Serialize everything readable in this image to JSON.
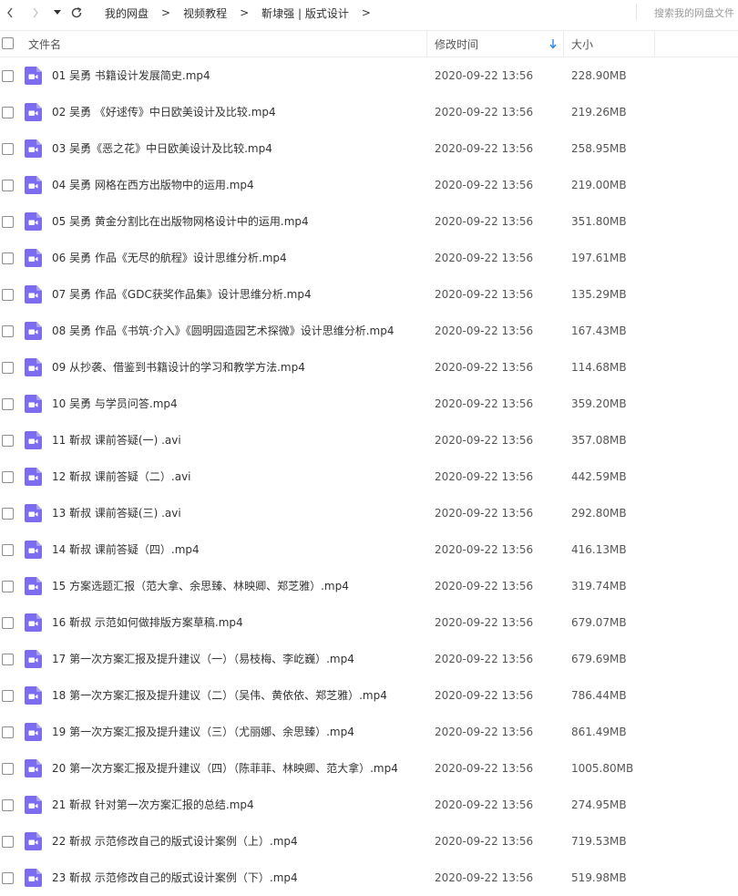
{
  "breadcrumb": {
    "items": [
      "我的网盘",
      "视频教程",
      "靳埭强 | 版式设计"
    ],
    "separator": ">"
  },
  "search": {
    "placeholder": "搜索我的网盘文件"
  },
  "columns": {
    "name": "文件名",
    "time": "修改时间",
    "size": "大小"
  },
  "sort_icon": "arrow-down-icon",
  "colors": {
    "video_icon": "#7b6cf0",
    "sort_arrow": "#2b8ae8"
  },
  "files": [
    {
      "name": "01 吴勇 书籍设计发展简史.mp4",
      "time": "2020-09-22 13:56",
      "size": "228.90MB"
    },
    {
      "name": "02 吴勇 《好逑传》中日欧美设计及比较.mp4",
      "time": "2020-09-22 13:56",
      "size": "219.26MB"
    },
    {
      "name": "03 吴勇《恶之花》中日欧美设计及比较.mp4",
      "time": "2020-09-22 13:56",
      "size": "258.95MB"
    },
    {
      "name": "04 吴勇 网格在西方出版物中的运用.mp4",
      "time": "2020-09-22 13:56",
      "size": "219.00MB"
    },
    {
      "name": "05 吴勇 黄金分割比在出版物网格设计中的运用.mp4",
      "time": "2020-09-22 13:56",
      "size": "351.80MB"
    },
    {
      "name": "06 吴勇 作品《无尽的航程》设计思维分析.mp4",
      "time": "2020-09-22 13:56",
      "size": "197.61MB"
    },
    {
      "name": "07 吴勇 作品《GDC获奖作品集》设计思维分析.mp4",
      "time": "2020-09-22 13:56",
      "size": "135.29MB"
    },
    {
      "name": "08 吴勇 作品《书筑·介入》《圆明园造园艺术探微》设计思维分析.mp4",
      "time": "2020-09-22 13:56",
      "size": "167.43MB"
    },
    {
      "name": "09 从抄袭、借鉴到书籍设计的学习和教学方法.mp4",
      "time": "2020-09-22 13:56",
      "size": "114.68MB"
    },
    {
      "name": "10 吴勇 与学员问答.mp4",
      "time": "2020-09-22 13:56",
      "size": "359.20MB"
    },
    {
      "name": "11 靳叔 课前答疑(一) .avi",
      "time": "2020-09-22 13:56",
      "size": "357.08MB"
    },
    {
      "name": "12 靳叔 课前答疑（二）.avi",
      "time": "2020-09-22 13:56",
      "size": "442.59MB"
    },
    {
      "name": "13 靳叔 课前答疑(三) .avi",
      "time": "2020-09-22 13:56",
      "size": "292.80MB"
    },
    {
      "name": "14 靳叔 课前答疑（四）.mp4",
      "time": "2020-09-22 13:56",
      "size": "416.13MB"
    },
    {
      "name": "15 方案选题汇报（范大拿、余思臻、林映卿、郑芝雅）.mp4",
      "time": "2020-09-22 13:56",
      "size": "319.74MB"
    },
    {
      "name": "16 靳叔 示范如何做排版方案草稿.mp4",
      "time": "2020-09-22 13:56",
      "size": "679.07MB"
    },
    {
      "name": "17 第一次方案汇报及提升建议（一）（易枝梅、李屹巍）.mp4",
      "time": "2020-09-22 13:56",
      "size": "679.69MB"
    },
    {
      "name": "18 第一次方案汇报及提升建议（二）（吴伟、黄依依、郑芝雅）.mp4",
      "time": "2020-09-22 13:56",
      "size": "786.44MB"
    },
    {
      "name": "19 第一次方案汇报及提升建议（三）（尤丽娜、余思臻）.mp4",
      "time": "2020-09-22 13:56",
      "size": "861.49MB"
    },
    {
      "name": "20 第一次方案汇报及提升建议（四）（陈菲菲、林映卿、范大拿）.mp4",
      "time": "2020-09-22 13:56",
      "size": "1005.80MB"
    },
    {
      "name": "21 靳叔 针对第一次方案汇报的总结.mp4",
      "time": "2020-09-22 13:56",
      "size": "274.95MB"
    },
    {
      "name": "22 靳叔 示范修改自己的版式设计案例（上）.mp4",
      "time": "2020-09-22 13:56",
      "size": "719.53MB"
    },
    {
      "name": "23 靳叔 示范修改自己的版式设计案例（下）.mp4",
      "time": "2020-09-22 13:56",
      "size": "519.98MB"
    }
  ]
}
